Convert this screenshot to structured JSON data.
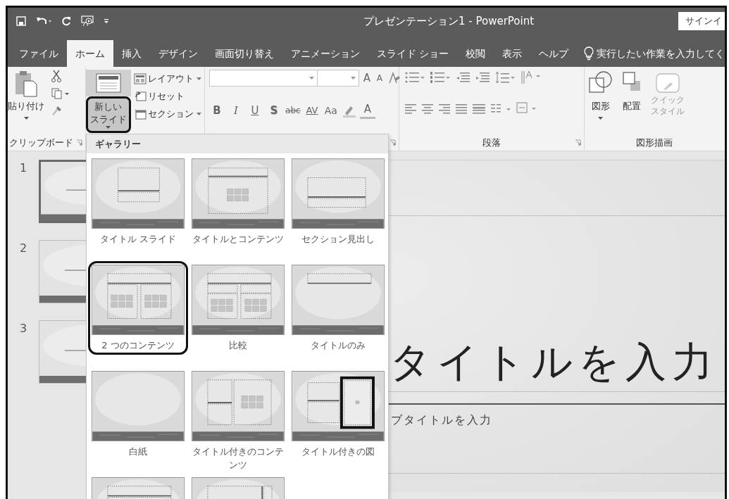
{
  "title_bar": {
    "title": "プレゼンテーション1 - PowerPoint",
    "sign_in": "サインイ"
  },
  "tabs": [
    {
      "label": "ファイル",
      "selected": false
    },
    {
      "label": "ホーム",
      "selected": true
    },
    {
      "label": "挿入",
      "selected": false
    },
    {
      "label": "デザイン",
      "selected": false
    },
    {
      "label": "画面切り替え",
      "selected": false
    },
    {
      "label": "アニメーション",
      "selected": false
    },
    {
      "label": "スライド ショー",
      "selected": false
    },
    {
      "label": "校閲",
      "selected": false
    },
    {
      "label": "表示",
      "selected": false
    },
    {
      "label": "ヘルプ",
      "selected": false
    }
  ],
  "tell_me": {
    "placeholder": "実行したい作業を入力してく"
  },
  "clipboard": {
    "paste": "貼り付け",
    "label": "クリップボード"
  },
  "slides_group": {
    "new_slide": [
      "新しい",
      "スライド"
    ],
    "highlighted": true,
    "commands": [
      "レイアウト",
      "リセット",
      "セクション"
    ]
  },
  "font_group": {
    "size_buttons": [
      {
        "text": "A",
        "kind": "grow"
      },
      {
        "text": "A",
        "kind": "shrink"
      }
    ],
    "buttons": [
      {
        "text": "B",
        "kind": "bold"
      },
      {
        "text": "I",
        "kind": "italic"
      },
      {
        "text": "U",
        "kind": "underline"
      },
      {
        "text": "S",
        "kind": "shadow"
      },
      {
        "text": "abc",
        "kind": "strike"
      },
      {
        "text": "AV",
        "kind": "spacing"
      },
      {
        "text": "Aa",
        "kind": "case"
      }
    ],
    "color_button": "A"
  },
  "paragraph_group": {
    "label": "段落"
  },
  "drawing_group": {
    "shapes": "図形",
    "arrange": "配置",
    "quick_styles": [
      "クイック",
      "スタイル"
    ],
    "quick_styles_disabled": true,
    "label": "図形描画"
  },
  "gallery": {
    "header": "ギャラリー",
    "layouts": [
      {
        "label": "タイトル スライド",
        "kind": "title",
        "selected": false
      },
      {
        "label": "タイトルとコンテンツ",
        "kind": "title_content",
        "selected": false
      },
      {
        "label": "セクション見出し",
        "kind": "section",
        "selected": false
      },
      {
        "label": "2 つのコンテンツ",
        "kind": "two_content",
        "selected": true
      },
      {
        "label": "比較",
        "kind": "comparison",
        "selected": false
      },
      {
        "label": "タイトルのみ",
        "kind": "title_only",
        "selected": false
      },
      {
        "label": "白紙",
        "kind": "blank",
        "selected": false
      },
      {
        "label": "タイトル付きのコンテンツ",
        "kind": "content_caption",
        "selected": false
      },
      {
        "label": "タイトル付きの図",
        "kind": "picture_caption",
        "selected": false
      },
      {
        "kind": "title_top",
        "selected": false
      },
      {
        "kind": "vertical",
        "selected": false
      }
    ]
  },
  "slide_pane": [
    {
      "number": "1",
      "selected": true
    },
    {
      "number": "2",
      "selected": false
    },
    {
      "number": "3",
      "selected": false
    }
  ],
  "slide": {
    "title": "タイトルを入力",
    "subtitle": "ブタイトルを入力"
  }
}
